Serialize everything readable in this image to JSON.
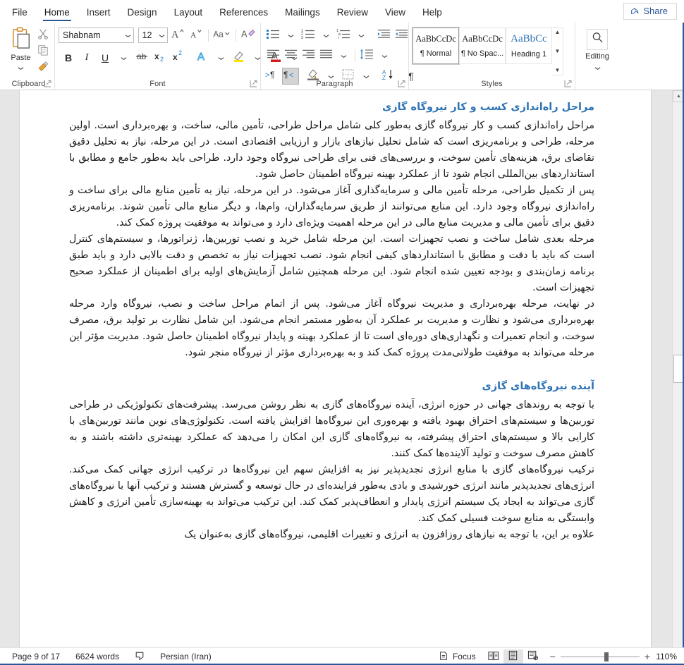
{
  "window": {
    "share_label": "Share",
    "share_icon": "share-icon"
  },
  "tabs": [
    {
      "label": "File",
      "active": false
    },
    {
      "label": "Home",
      "active": true
    },
    {
      "label": "Insert",
      "active": false
    },
    {
      "label": "Design",
      "active": false
    },
    {
      "label": "Layout",
      "active": false
    },
    {
      "label": "References",
      "active": false
    },
    {
      "label": "Mailings",
      "active": false
    },
    {
      "label": "Review",
      "active": false
    },
    {
      "label": "View",
      "active": false
    },
    {
      "label": "Help",
      "active": false
    }
  ],
  "ribbon": {
    "clipboard": {
      "group_label": "Clipboard",
      "paste_label": "Paste",
      "items": [
        "paste-icon",
        "cut-icon",
        "copy-icon",
        "format-painter-icon"
      ]
    },
    "font": {
      "group_label": "Font",
      "font_name": "Shabnam",
      "font_size": "12",
      "buttons": [
        "grow-font",
        "shrink-font",
        "change-case",
        "clear-formatting",
        "bold",
        "italic",
        "underline",
        "strikethrough",
        "subscript",
        "superscript",
        "text-effects",
        "text-highlight",
        "font-color"
      ]
    },
    "paragraph": {
      "group_label": "Paragraph",
      "buttons": [
        "bullets",
        "numbering",
        "multilevel-list",
        "decrease-indent",
        "increase-indent",
        "align-left",
        "align-center",
        "align-right",
        "justify",
        "line-spacing",
        "ltr-text-direction",
        "rtl-text-direction",
        "shading",
        "borders",
        "sort",
        "show-formatting-marks"
      ],
      "active_button": "rtl-text-direction"
    },
    "styles": {
      "group_label": "Styles",
      "gallery": [
        {
          "preview": "AaBbCcDc",
          "name": "¶ Normal",
          "selected": true
        },
        {
          "preview": "AaBbCcDc",
          "name": "¶ No Spac...",
          "selected": false
        },
        {
          "preview": "AaBbCc",
          "name": "Heading 1",
          "selected": false
        }
      ]
    },
    "editing": {
      "group_label": "",
      "label": "Editing",
      "icon": "search-icon"
    }
  },
  "document": {
    "blocks": [
      {
        "type": "heading",
        "text": "مراحل راه‌اندازی کسب و کار نیروگاه گازی"
      },
      {
        "type": "paragraph",
        "text": "مراحل راه‌اندازی کسب و کار نیروگاه گازی به‌طور کلی شامل مراحل طراحی، تأمین مالی، ساخت، و بهره‌برداری است. اولین مرحله، طراحی و برنامه‌ریزی است که شامل تحلیل نیازهای بازار و ارزیابی اقتصادی است. در این مرحله، نیاز به تحلیل دقیق تقاضای برق، هزینه‌های تأمین سوخت، و بررسی‌های فنی برای طراحی نیروگاه وجود دارد. طراحی باید به‌طور جامع و مطابق با استانداردهای بین‌المللی انجام شود تا از عملکرد بهینه نیروگاه اطمینان حاصل شود."
      },
      {
        "type": "paragraph",
        "text": "پس از تکمیل طراحی، مرحله تأمین مالی و سرمایه‌گذاری آغاز می‌شود. در این مرحله، نیاز به تأمین منابع مالی برای ساخت و راه‌اندازی نیروگاه وجود دارد. این منابع می‌توانند از طریق سرمایه‌گذاران، وام‌ها، و دیگر منابع مالی تأمین شوند. برنامه‌ریزی دقیق برای تأمین مالی و مدیریت منابع مالی در این مرحله اهمیت ویژه‌ای دارد و می‌تواند به موفقیت پروژه کمک کند."
      },
      {
        "type": "paragraph",
        "text": "مرحله بعدی شامل ساخت و نصب تجهیزات است. این مرحله شامل خرید و نصب توربین‌ها، ژنراتورها، و سیستم‌های کنترل است که باید با دقت و مطابق با استانداردهای کیفی انجام شود. نصب تجهیزات نیاز به تخصص و دقت بالایی دارد و باید طبق برنامه زمان‌بندی و بودجه تعیین شده انجام شود. این مرحله همچنین شامل آزمایش‌های اولیه برای اطمینان از عملکرد صحیح تجهیزات است."
      },
      {
        "type": "paragraph",
        "text": "در نهایت، مرحله بهره‌برداری و مدیریت نیروگاه آغاز می‌شود. پس از اتمام مراحل ساخت و نصب، نیروگاه وارد مرحله بهره‌برداری می‌شود و نظارت و مدیریت بر عملکرد آن به‌طور مستمر انجام می‌شود. این شامل نظارت بر تولید برق، مصرف سوخت، و انجام تعمیرات و نگهداری‌های دوره‌ای است تا از عملکرد بهینه و پایدار نیروگاه اطمینان حاصل شود. مدیریت مؤثر این مرحله می‌تواند به موفقیت طولانی‌مدت پروژه کمک کند و به بهره‌برداری مؤثر از نیروگاه منجر شود."
      },
      {
        "type": "heading",
        "text": "آینده نیروگاه‌های گازی",
        "spaced": true
      },
      {
        "type": "paragraph",
        "text": "با توجه به روندهای جهانی در حوزه انرژی، آینده نیروگاه‌های گازی به نظر روشن می‌رسد. پیشرفت‌های تکنولوژیکی در طراحی توربین‌ها و سیستم‌های احتراق بهبود یافته و بهره‌وری این نیروگاه‌ها افزایش یافته است. تکنولوژی‌های نوین مانند توربین‌های با کارایی بالا و سیستم‌های احتراق پیشرفته، به نیروگاه‌های گازی این امکان را می‌دهد که عملکرد بهینه‌تری داشته باشند و به کاهش مصرف سوخت و تولید آلاینده‌ها کمک کنند."
      },
      {
        "type": "paragraph",
        "text": "ترکیب نیروگاه‌های گازی با منابع انرژی تجدیدپذیر نیز به افزایش سهم این نیروگاه‌ها در ترکیب انرژی جهانی کمک می‌کند. انرژی‌های تجدیدپذیر مانند انرژی خورشیدی و بادی به‌طور فزاینده‌ای در حال توسعه و گسترش هستند و ترکیب آنها با نیروگاه‌های گازی می‌تواند به ایجاد یک سیستم انرژی پایدار و انعطاف‌پذیر کمک کند. این ترکیب می‌تواند به بهینه‌سازی تأمین انرژی و کاهش وابستگی به منابع سوخت فسیلی کمک کند."
      },
      {
        "type": "paragraph",
        "text": "علاوه بر این، با توجه به نیازهای روزافزون به انرژی و تغییرات اقلیمی، نیروگاه‌های گازی به‌عنوان یک"
      }
    ]
  },
  "statusbar": {
    "page_indicator": "Page 9 of 17",
    "word_count": "6624 words",
    "proofing_icon": "proofing-icon",
    "language": "Persian (Iran)",
    "focus_label": "Focus",
    "focus_icon": "focus-icon",
    "views": [
      {
        "name": "read-mode-view",
        "active": false
      },
      {
        "name": "print-layout-view",
        "active": true
      },
      {
        "name": "web-layout-view",
        "active": false
      }
    ],
    "zoom_out": "−",
    "zoom_in": "+",
    "zoom_level": "110%"
  },
  "colors": {
    "accent": "#2b579a",
    "heading": "#2e74b5",
    "chrome": "#ffffff",
    "doc_background": "#e6e6e6"
  }
}
